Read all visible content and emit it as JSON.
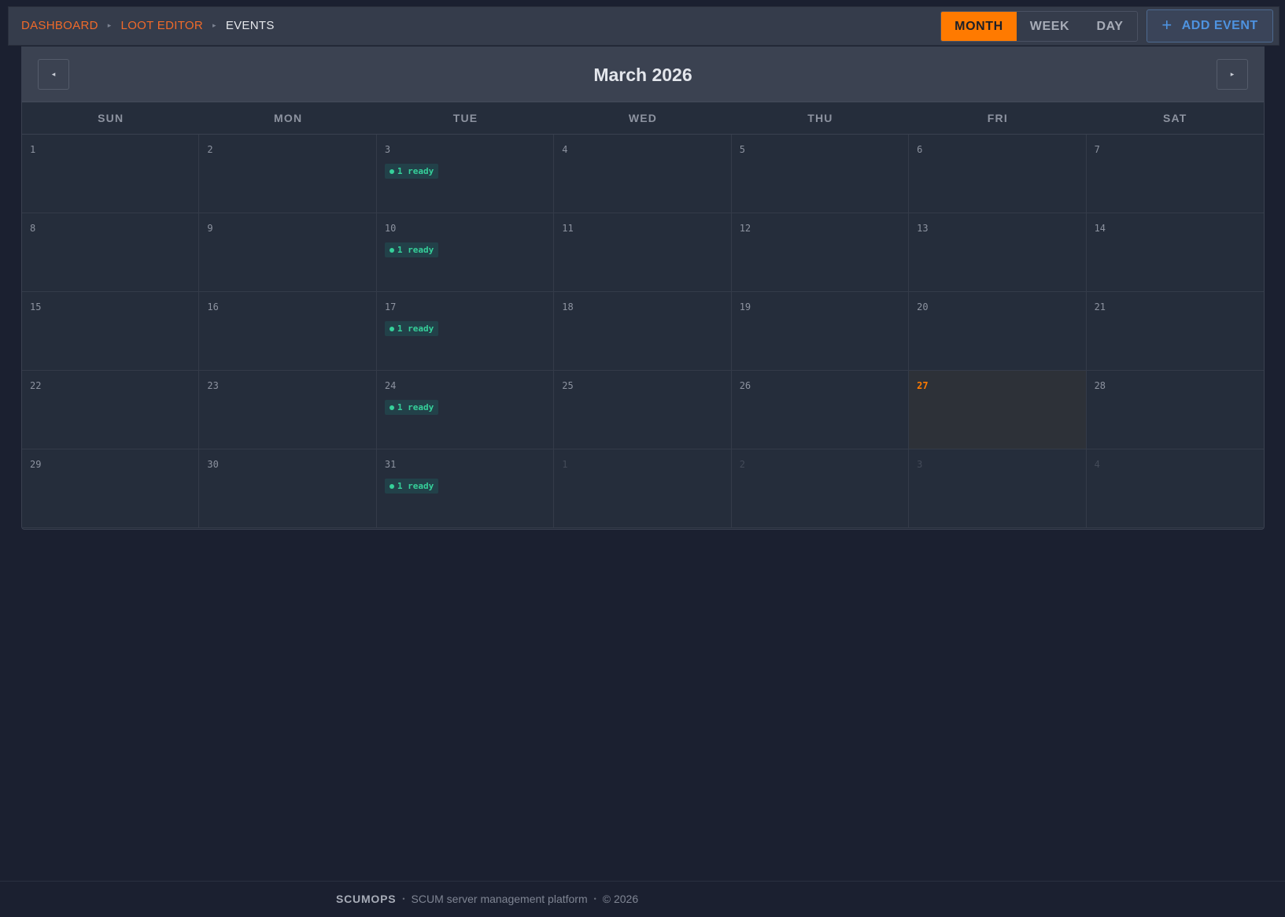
{
  "breadcrumb": {
    "items": [
      {
        "label": "DASHBOARD"
      },
      {
        "label": "LOOT EDITOR"
      },
      {
        "label": "EVENTS"
      }
    ],
    "separator": "▸"
  },
  "view_toggle": {
    "month": "MONTH",
    "week": "WEEK",
    "day": "DAY",
    "active": "month"
  },
  "add_event": {
    "icon": "+",
    "label": "ADD EVENT"
  },
  "calendar": {
    "title": "March 2026",
    "prev_icon": "◂",
    "next_icon": "▸",
    "weekdays": [
      "SUN",
      "MON",
      "TUE",
      "WED",
      "THU",
      "FRI",
      "SAT"
    ],
    "badge_text": "1 ready",
    "cells": [
      {
        "day": "1"
      },
      {
        "day": "2"
      },
      {
        "day": "3",
        "badge": "1 ready"
      },
      {
        "day": "4"
      },
      {
        "day": "5"
      },
      {
        "day": "6"
      },
      {
        "day": "7"
      },
      {
        "day": "8"
      },
      {
        "day": "9"
      },
      {
        "day": "10",
        "badge": "1 ready"
      },
      {
        "day": "11"
      },
      {
        "day": "12"
      },
      {
        "day": "13"
      },
      {
        "day": "14"
      },
      {
        "day": "15"
      },
      {
        "day": "16"
      },
      {
        "day": "17",
        "badge": "1 ready"
      },
      {
        "day": "18"
      },
      {
        "day": "19"
      },
      {
        "day": "20"
      },
      {
        "day": "21"
      },
      {
        "day": "22"
      },
      {
        "day": "23"
      },
      {
        "day": "24",
        "badge": "1 ready"
      },
      {
        "day": "25"
      },
      {
        "day": "26"
      },
      {
        "day": "27",
        "today": true
      },
      {
        "day": "28"
      },
      {
        "day": "29"
      },
      {
        "day": "30"
      },
      {
        "day": "31",
        "badge": "1 ready"
      },
      {
        "day": "1",
        "other": true
      },
      {
        "day": "2",
        "other": true
      },
      {
        "day": "3",
        "other": true
      },
      {
        "day": "4",
        "other": true
      }
    ]
  },
  "footer": {
    "brand": "SCUMOPS",
    "separator": "•",
    "tagline": "SCUM server management platform",
    "copyright": "© 2026"
  },
  "colors": {
    "accent": "#ff7a00",
    "link": "#f06a2a",
    "ready": "#36d09a",
    "add_event": "#4e93e0"
  }
}
